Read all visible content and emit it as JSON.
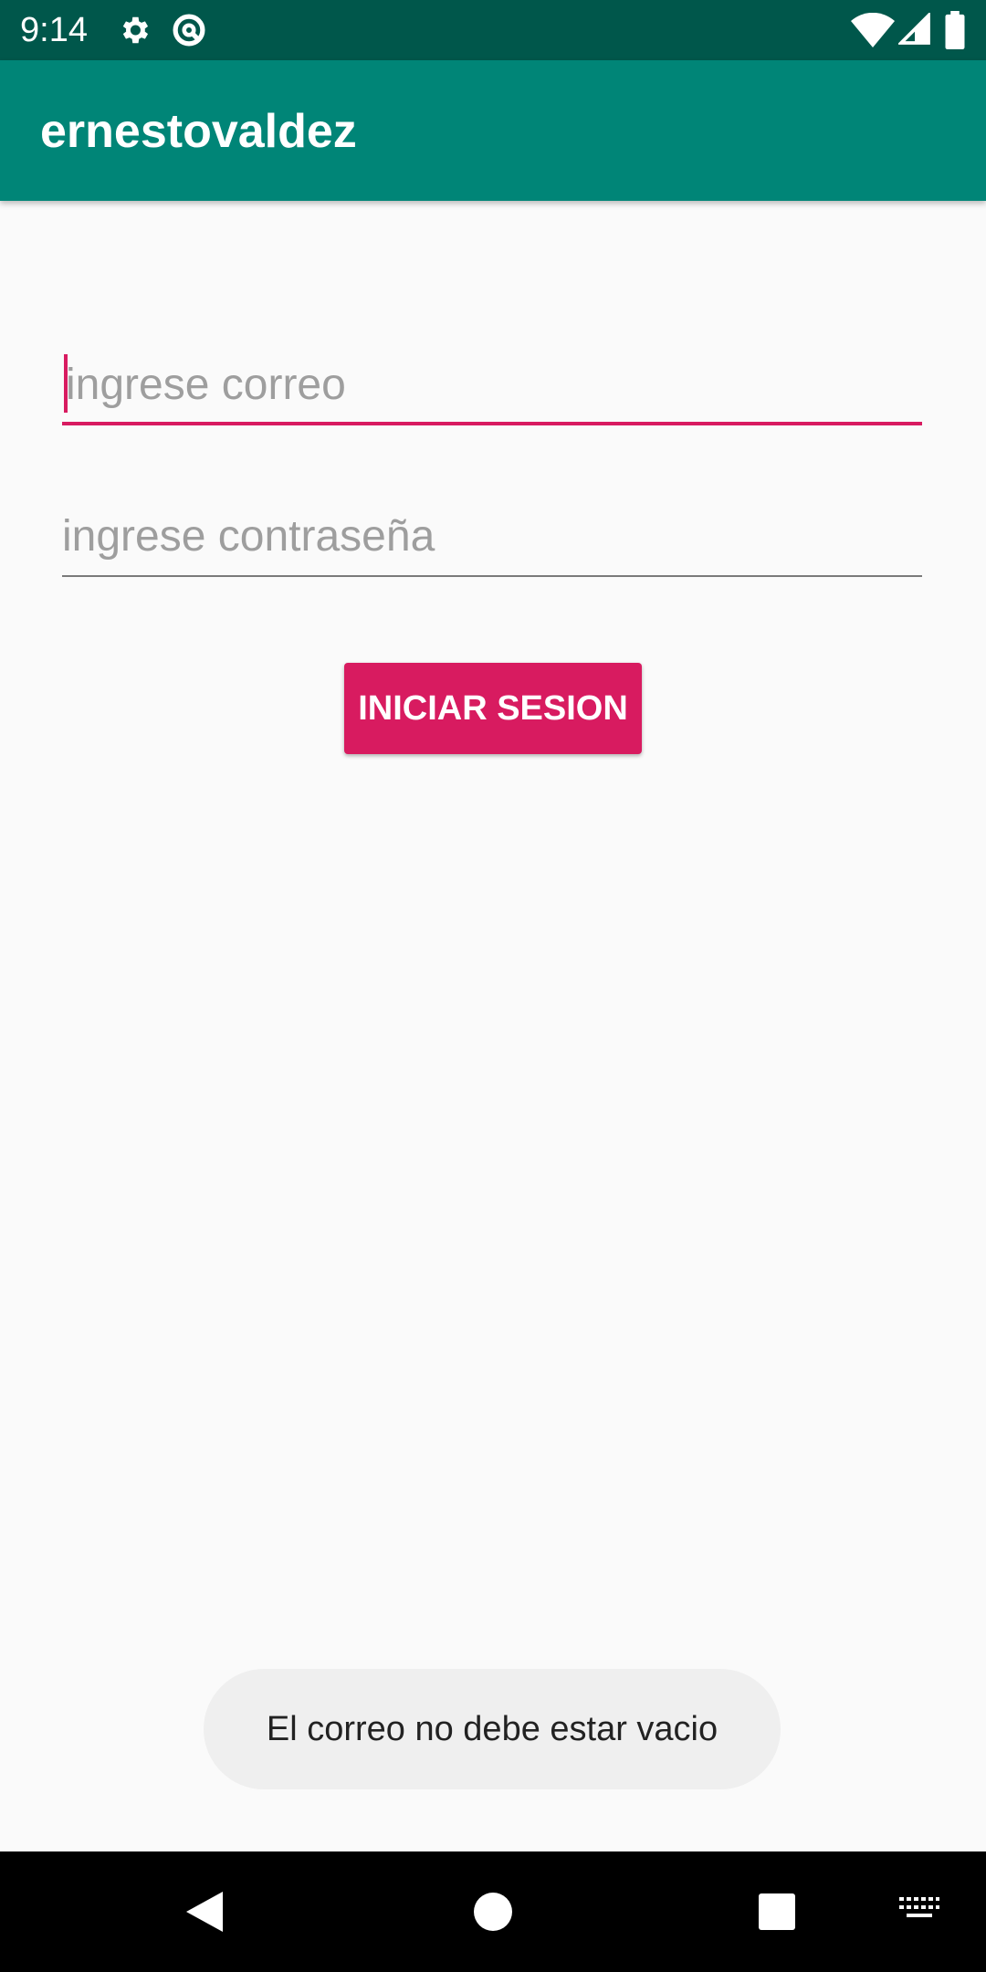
{
  "status_bar": {
    "time": "9:14",
    "left_icons": [
      "gear-icon",
      "data-saver-icon"
    ],
    "right_icons": [
      "wifi-icon",
      "signal-icon",
      "battery-icon"
    ]
  },
  "app_bar": {
    "title": "ernestovaldez"
  },
  "form": {
    "email_placeholder": "ingrese correo",
    "email_value": "",
    "password_placeholder": "ingrese contraseña",
    "password_value": "",
    "login_label": "INICIAR SESION"
  },
  "toast": {
    "message": "El correo no debe estar vacio"
  },
  "nav_bar": {
    "icons": [
      "back-icon",
      "home-icon",
      "recents-icon",
      "keyboard-icon"
    ]
  },
  "colors": {
    "primary": "#008577",
    "primary_dark": "#00574B",
    "accent": "#D81B60"
  }
}
